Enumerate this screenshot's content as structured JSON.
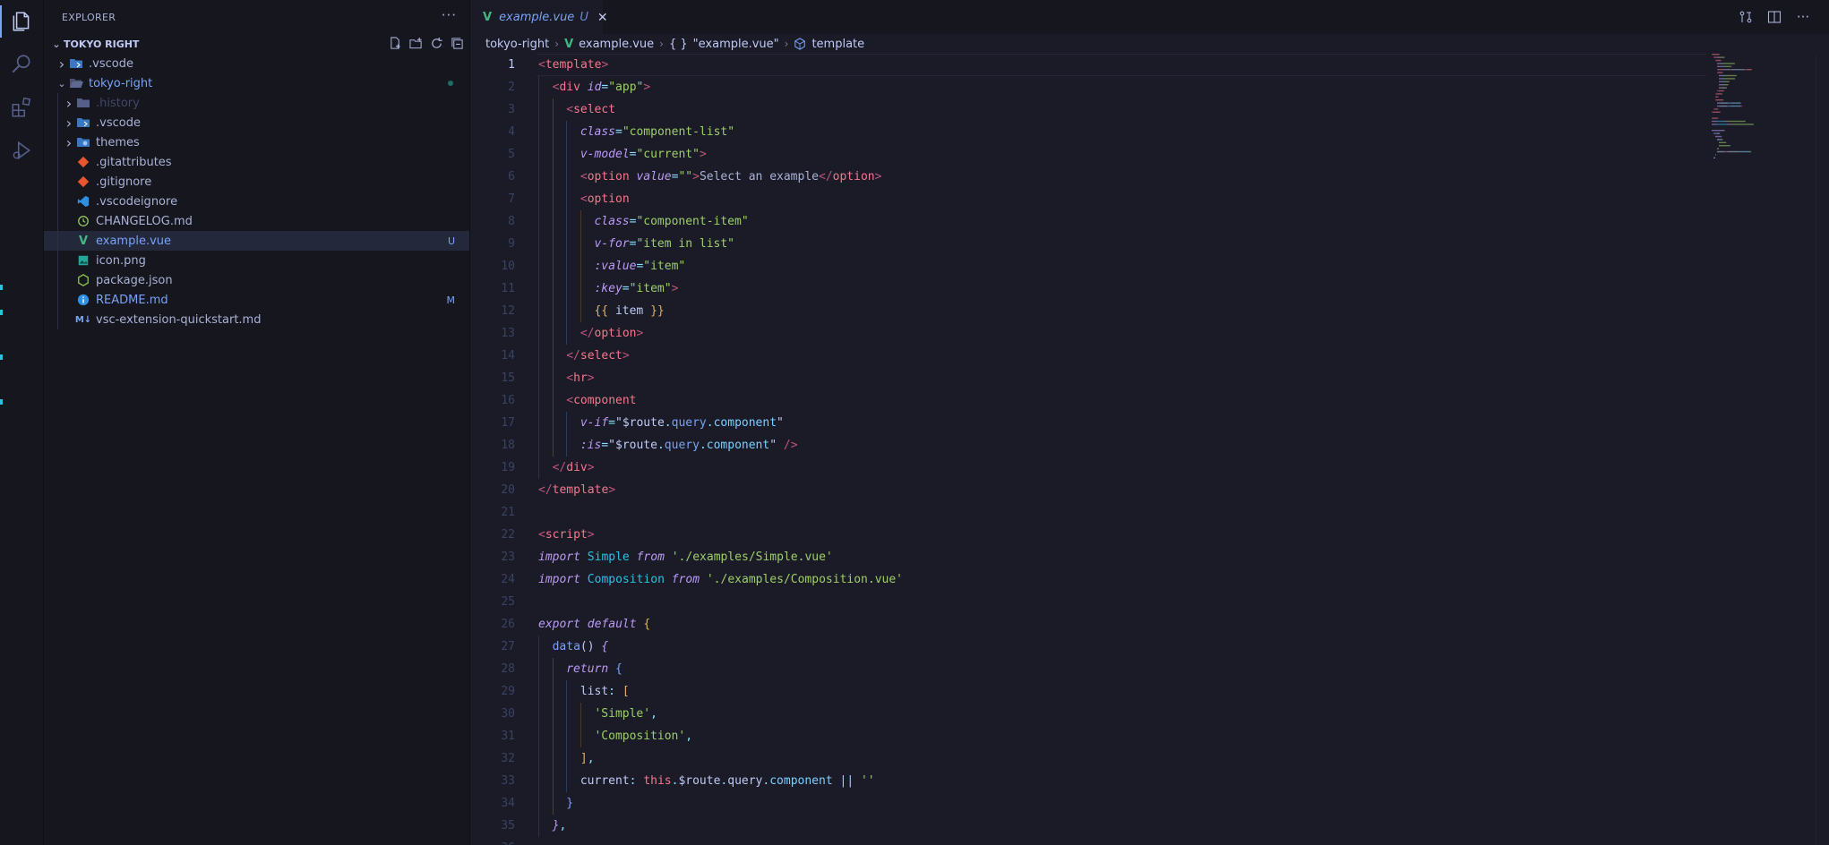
{
  "explorer": {
    "title": "EXPLORER",
    "more_label": "···",
    "root": "TOKYO RIGHT",
    "items": [
      {
        "label": ".vscode",
        "depth": 0,
        "kind": "folder",
        "icon": "vscode-folder-icon",
        "badge": ""
      },
      {
        "label": "tokyo-right",
        "depth": 0,
        "kind": "folder-open",
        "icon": "folder-open-icon",
        "badge": "dot"
      },
      {
        "label": ".history",
        "depth": 1,
        "kind": "folder",
        "icon": "folder-icon",
        "badge": ""
      },
      {
        "label": ".vscode",
        "depth": 1,
        "kind": "folder",
        "icon": "vscode-folder-icon",
        "badge": ""
      },
      {
        "label": "themes",
        "depth": 1,
        "kind": "folder",
        "icon": "themes-folder-icon",
        "badge": ""
      },
      {
        "label": ".gitattributes",
        "depth": 1,
        "kind": "file",
        "icon": "git-icon",
        "badge": ""
      },
      {
        "label": ".gitignore",
        "depth": 1,
        "kind": "file",
        "icon": "git-icon",
        "badge": ""
      },
      {
        "label": ".vscodeignore",
        "depth": 1,
        "kind": "file",
        "icon": "vscode-icon",
        "badge": ""
      },
      {
        "label": "CHANGELOG.md",
        "depth": 1,
        "kind": "file",
        "icon": "changelog-icon",
        "badge": ""
      },
      {
        "label": "example.vue",
        "depth": 1,
        "kind": "file",
        "icon": "vue-icon",
        "badge": "U"
      },
      {
        "label": "icon.png",
        "depth": 1,
        "kind": "file",
        "icon": "image-icon",
        "badge": ""
      },
      {
        "label": "package.json",
        "depth": 1,
        "kind": "file",
        "icon": "nodejs-icon",
        "badge": ""
      },
      {
        "label": "README.md",
        "depth": 1,
        "kind": "file",
        "icon": "info-icon",
        "badge": "M"
      },
      {
        "label": "vsc-extension-quickstart.md",
        "depth": 1,
        "kind": "file",
        "icon": "markdown-icon",
        "badge": ""
      }
    ]
  },
  "tab": {
    "name": "example.vue",
    "status": "U"
  },
  "breadcrumb": {
    "folder": "tokyo-right",
    "file": "example.vue",
    "object_label": "\"example.vue\"",
    "object_prefix": "{ }",
    "symbol": "template"
  },
  "editor": {
    "active_line": 1,
    "lines": [
      {
        "n": "1",
        "indent": 0,
        "tokens": [
          [
            "br",
            "<"
          ],
          [
            "tag",
            "template"
          ],
          [
            "br",
            ">"
          ]
        ]
      },
      {
        "n": "2",
        "indent": 1,
        "tokens": [
          [
            "br",
            "<"
          ],
          [
            "tag",
            "div "
          ],
          [
            "attr",
            "id"
          ],
          [
            "pun",
            "="
          ],
          [
            "str",
            "\"app\""
          ],
          [
            "br",
            ">"
          ]
        ]
      },
      {
        "n": "3",
        "indent": 2,
        "tokens": [
          [
            "br",
            "<"
          ],
          [
            "tag",
            "select"
          ]
        ]
      },
      {
        "n": "4",
        "indent": 3,
        "tokens": [
          [
            "attr",
            "class"
          ],
          [
            "pun",
            "="
          ],
          [
            "str",
            "\"component-list\""
          ]
        ]
      },
      {
        "n": "5",
        "indent": 3,
        "tokens": [
          [
            "attr",
            "v-model"
          ],
          [
            "pun",
            "="
          ],
          [
            "str",
            "\"current\""
          ],
          [
            "br",
            ">"
          ]
        ]
      },
      {
        "n": "6",
        "indent": 3,
        "tokens": [
          [
            "br",
            "<"
          ],
          [
            "tag",
            "option "
          ],
          [
            "attr",
            "value"
          ],
          [
            "pun",
            "="
          ],
          [
            "str",
            "\"\""
          ],
          [
            "br",
            ">"
          ],
          [
            "txt",
            "Select an example"
          ],
          [
            "br",
            "</"
          ],
          [
            "tag",
            "option"
          ],
          [
            "br",
            ">"
          ]
        ]
      },
      {
        "n": "7",
        "indent": 3,
        "tokens": [
          [
            "br",
            "<"
          ],
          [
            "tag",
            "option"
          ]
        ]
      },
      {
        "n": "8",
        "indent": 4,
        "tokens": [
          [
            "attr",
            "class"
          ],
          [
            "pun",
            "="
          ],
          [
            "str",
            "\"component-item\""
          ]
        ]
      },
      {
        "n": "9",
        "indent": 4,
        "tokens": [
          [
            "attr",
            "v-for"
          ],
          [
            "pun",
            "="
          ],
          [
            "str",
            "\"item in list\""
          ]
        ]
      },
      {
        "n": "10",
        "indent": 4,
        "tokens": [
          [
            "attr",
            ":value"
          ],
          [
            "pun",
            "="
          ],
          [
            "str",
            "\"item\""
          ]
        ]
      },
      {
        "n": "11",
        "indent": 4,
        "tokens": [
          [
            "attr",
            ":key"
          ],
          [
            "pun",
            "="
          ],
          [
            "str",
            "\"item\""
          ],
          [
            "br",
            ">"
          ]
        ]
      },
      {
        "n": "12",
        "indent": 4,
        "tokens": [
          [
            "brace",
            "{{ "
          ],
          [
            "plain",
            "item "
          ],
          [
            "brace",
            "}}"
          ]
        ]
      },
      {
        "n": "13",
        "indent": 3,
        "tokens": [
          [
            "br",
            "</"
          ],
          [
            "tag",
            "option"
          ],
          [
            "br",
            ">"
          ]
        ]
      },
      {
        "n": "14",
        "indent": 2,
        "tokens": [
          [
            "br",
            "</"
          ],
          [
            "tag",
            "select"
          ],
          [
            "br",
            ">"
          ]
        ]
      },
      {
        "n": "15",
        "indent": 2,
        "tokens": [
          [
            "br",
            "<"
          ],
          [
            "tag",
            "hr"
          ],
          [
            "br",
            ">"
          ]
        ]
      },
      {
        "n": "16",
        "indent": 2,
        "tokens": [
          [
            "br",
            "<"
          ],
          [
            "tag",
            "component"
          ]
        ]
      },
      {
        "n": "17",
        "indent": 3,
        "tokens": [
          [
            "attr",
            "v-if"
          ],
          [
            "pun",
            "="
          ],
          [
            "plain",
            "\"$route"
          ],
          [
            "pun",
            "."
          ],
          [
            "fn",
            "query"
          ],
          [
            "pun",
            "."
          ],
          [
            "prop",
            "component"
          ],
          [
            "plain",
            "\""
          ]
        ]
      },
      {
        "n": "18",
        "indent": 3,
        "tokens": [
          [
            "attr",
            ":is"
          ],
          [
            "pun",
            "="
          ],
          [
            "plain",
            "\"$route"
          ],
          [
            "pun",
            "."
          ],
          [
            "fn",
            "query"
          ],
          [
            "pun",
            "."
          ],
          [
            "prop",
            "component"
          ],
          [
            "plain",
            "\" "
          ],
          [
            "br",
            "/>"
          ]
        ]
      },
      {
        "n": "19",
        "indent": 1,
        "tokens": [
          [
            "br",
            "</"
          ],
          [
            "tag",
            "div"
          ],
          [
            "br",
            ">"
          ]
        ]
      },
      {
        "n": "20",
        "indent": 0,
        "tokens": [
          [
            "br",
            "</"
          ],
          [
            "tag",
            "template"
          ],
          [
            "br",
            ">"
          ]
        ]
      },
      {
        "n": "21",
        "indent": 0,
        "tokens": []
      },
      {
        "n": "22",
        "indent": 0,
        "tokens": [
          [
            "br",
            "<"
          ],
          [
            "tag",
            "script"
          ],
          [
            "br",
            ">"
          ]
        ]
      },
      {
        "n": "23",
        "indent": 0,
        "tokens": [
          [
            "kw",
            "import "
          ],
          [
            "cls",
            "Simple "
          ],
          [
            "kw",
            "from "
          ],
          [
            "str",
            "'./examples/Simple.vue'"
          ]
        ]
      },
      {
        "n": "24",
        "indent": 0,
        "tokens": [
          [
            "kw",
            "import "
          ],
          [
            "cls",
            "Composition "
          ],
          [
            "kw",
            "from "
          ],
          [
            "str",
            "'./examples/Composition.vue'"
          ]
        ]
      },
      {
        "n": "25",
        "indent": 0,
        "tokens": []
      },
      {
        "n": "26",
        "indent": 0,
        "tokens": [
          [
            "kw",
            "export default "
          ],
          [
            "brace",
            "{"
          ]
        ]
      },
      {
        "n": "27",
        "indent": 1,
        "tokens": [
          [
            "fn",
            "data"
          ],
          [
            "plain",
            "() "
          ],
          [
            "attr",
            "{"
          ]
        ]
      },
      {
        "n": "28",
        "indent": 2,
        "tokens": [
          [
            "kw",
            "return "
          ],
          [
            "fn",
            "{"
          ]
        ]
      },
      {
        "n": "29",
        "indent": 3,
        "tokens": [
          [
            "plain",
            "list"
          ],
          [
            "pun",
            ": "
          ],
          [
            "brace",
            "["
          ]
        ]
      },
      {
        "n": "30",
        "indent": 4,
        "tokens": [
          [
            "str",
            "'Simple'"
          ],
          [
            "pun",
            ","
          ]
        ]
      },
      {
        "n": "31",
        "indent": 4,
        "tokens": [
          [
            "str",
            "'Composition'"
          ],
          [
            "pun",
            ","
          ]
        ]
      },
      {
        "n": "32",
        "indent": 3,
        "tokens": [
          [
            "brace",
            "]"
          ],
          [
            "pun",
            ","
          ]
        ]
      },
      {
        "n": "33",
        "indent": 3,
        "tokens": [
          [
            "plain",
            "current"
          ],
          [
            "pun",
            ": "
          ],
          [
            "this",
            "this"
          ],
          [
            "pun",
            "."
          ],
          [
            "plain",
            "$route"
          ],
          [
            "pun",
            "."
          ],
          [
            "plain",
            "query"
          ],
          [
            "pun",
            "."
          ],
          [
            "prop",
            "component "
          ],
          [
            "pun",
            "|| "
          ],
          [
            "str",
            "''"
          ]
        ]
      },
      {
        "n": "34",
        "indent": 2,
        "tokens": [
          [
            "fn",
            "}"
          ]
        ]
      },
      {
        "n": "35",
        "indent": 1,
        "tokens": [
          [
            "attr",
            "}"
          ],
          [
            "pun",
            ","
          ]
        ]
      },
      {
        "n": "36",
        "indent": 0,
        "tokens": []
      }
    ]
  },
  "colors": {
    "background": "#1a1b26",
    "sidebar": "#16161e",
    "accent": "#7aa2f7",
    "tag": "#f7768e",
    "string": "#9ece6a",
    "keyword": "#bb9af7"
  }
}
